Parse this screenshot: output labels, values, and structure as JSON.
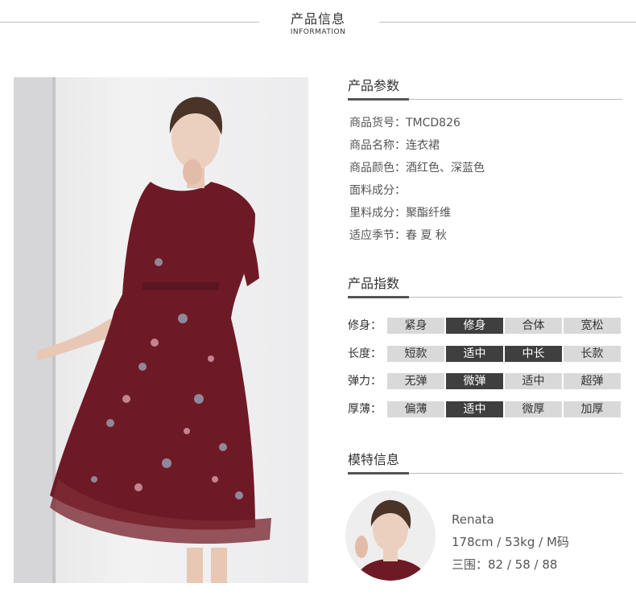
{
  "header": {
    "title": "产品信息",
    "subtitle": "INFORMATION"
  },
  "params": {
    "title": "产品参数",
    "rows": [
      {
        "label": "商品货号",
        "value": "TMCD826"
      },
      {
        "label": "商品名称",
        "value": "连衣裙"
      },
      {
        "label": "商品颜色",
        "value": "酒红色、深蓝色"
      },
      {
        "label": "面料成分",
        "value": ""
      },
      {
        "label": "里料成分",
        "value": "聚酯纤维"
      },
      {
        "label": "适应季节",
        "value": "春 夏 秋"
      }
    ]
  },
  "index": {
    "title": "产品指数",
    "rows": [
      {
        "label": "修身：",
        "options": [
          "紧身",
          "修身",
          "合体",
          "宽松"
        ],
        "selected": [
          "修身"
        ]
      },
      {
        "label": "长度：",
        "options": [
          "短款",
          "适中",
          "中长",
          "长款"
        ],
        "selected": [
          "适中",
          "中长"
        ]
      },
      {
        "label": "弹力：",
        "options": [
          "无弹",
          "微弹",
          "适中",
          "超弹"
        ],
        "selected": [
          "微弹"
        ]
      },
      {
        "label": "厚薄：",
        "options": [
          "偏薄",
          "适中",
          "微厚",
          "加厚"
        ],
        "selected": [
          "适中"
        ]
      }
    ]
  },
  "model": {
    "title": "模特信息",
    "name": "Renata",
    "stats": "178cm / 53kg / M码",
    "measurements": "三围：82 / 58 / 88"
  },
  "colors": {
    "dress": "#6e1a26",
    "accent": "#3f3f3f",
    "pill": "#d9d9d9"
  }
}
